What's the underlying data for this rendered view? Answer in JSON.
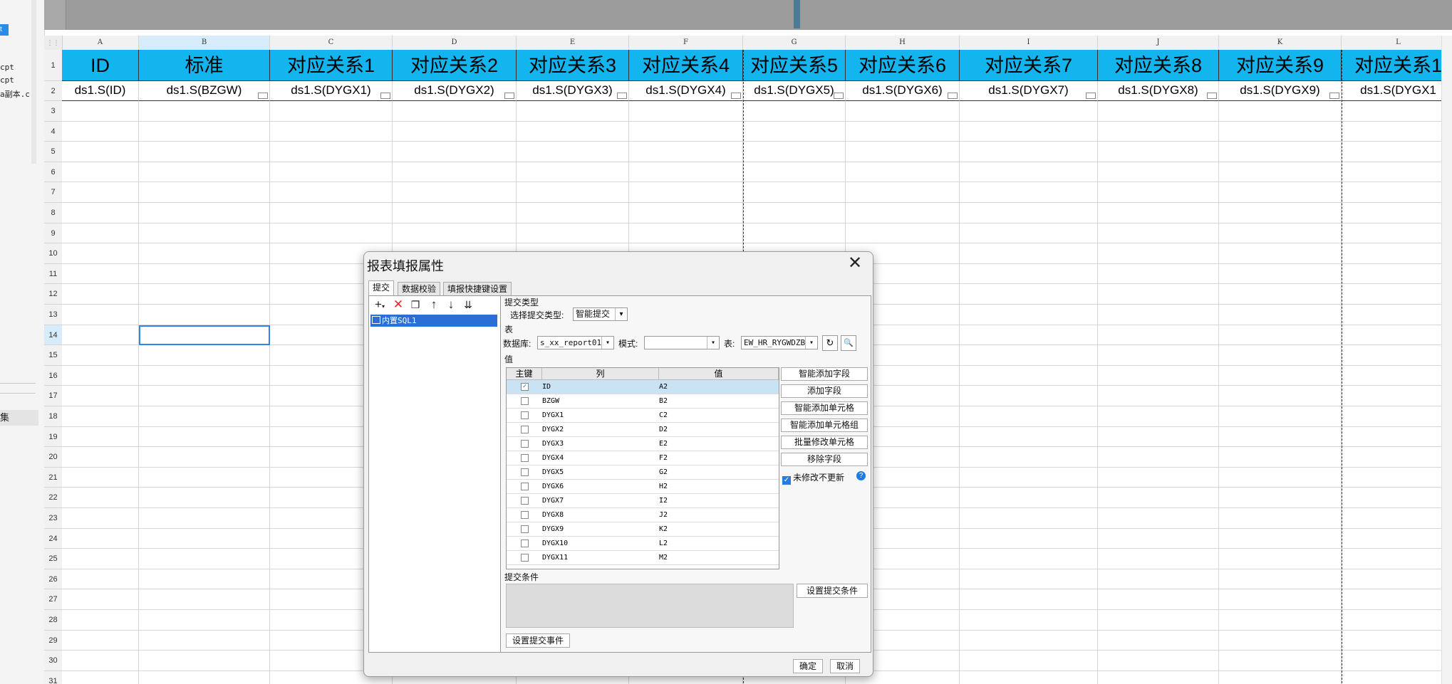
{
  "left_panel": {
    "selected_tag": "t",
    "items": [
      "cpt",
      "cpt",
      "a副本.c"
    ],
    "dataset_label": "集"
  },
  "sheet": {
    "columns": [
      "A",
      "B",
      "C",
      "D",
      "E",
      "F",
      "G",
      "H",
      "I",
      "J",
      "K",
      "L"
    ],
    "rows": [
      "1",
      "2",
      "3",
      "4",
      "5",
      "6",
      "7",
      "8",
      "9",
      "10",
      "11",
      "12",
      "13",
      "14",
      "15",
      "16",
      "17",
      "18",
      "19",
      "20",
      "21",
      "22",
      "23",
      "24",
      "25",
      "26",
      "27",
      "28",
      "29",
      "30",
      "31"
    ],
    "header_cells": [
      "ID",
      "标准",
      "对应关系1",
      "对应关系2",
      "对应关系3",
      "对应关系4",
      "对应关系5",
      "对应关系6",
      "对应关系7",
      "对应关系8",
      "对应关系9",
      "对应关系1"
    ],
    "value_cells": [
      "ds1.S(ID)",
      "ds1.S(BZGW)",
      "ds1.S(DYGX1)",
      "ds1.S(DYGX2)",
      "ds1.S(DYGX3)",
      "ds1.S(DYGX4)",
      "ds1.S(DYGX5)",
      "ds1.S(DYGX6)",
      "ds1.S(DYGX7)",
      "ds1.S(DYGX8)",
      "ds1.S(DYGX9)",
      "ds1.S(DYGX1"
    ],
    "colors": {
      "header_fill": "#13b5ef",
      "selection": "#2f86e8"
    }
  },
  "dialog": {
    "title": "报表填报属性",
    "close_icon": "close-icon",
    "tabs": [
      "提交",
      "数据校验",
      "填报快捷键设置"
    ],
    "toolbar_icons": [
      "add-icon",
      "delete-icon",
      "copy-icon",
      "move-up-icon",
      "move-down-icon",
      "move-bottom-icon"
    ],
    "tree_item": "内置SQL1",
    "submit_type_section": "提交类型",
    "submit_type_label": "选择提交类型:",
    "submit_type_value": "智能提交",
    "table_section": "表",
    "db_label": "数据库:",
    "db_value": "s_xx_report01",
    "schema_label": "模式:",
    "schema_value": "",
    "table_label": "表:",
    "table_value": "EW_HR_RYGWDZB",
    "value_section": "值",
    "grid_headers": [
      "主键",
      "列",
      "值"
    ],
    "grid_rows": [
      {
        "key": true,
        "col": "ID",
        "val": "A2"
      },
      {
        "key": false,
        "col": "BZGW",
        "val": "B2"
      },
      {
        "key": false,
        "col": "DYGX1",
        "val": "C2"
      },
      {
        "key": false,
        "col": "DYGX2",
        "val": "D2"
      },
      {
        "key": false,
        "col": "DYGX3",
        "val": "E2"
      },
      {
        "key": false,
        "col": "DYGX4",
        "val": "F2"
      },
      {
        "key": false,
        "col": "DYGX5",
        "val": "G2"
      },
      {
        "key": false,
        "col": "DYGX6",
        "val": "H2"
      },
      {
        "key": false,
        "col": "DYGX7",
        "val": "I2"
      },
      {
        "key": false,
        "col": "DYGX8",
        "val": "J2"
      },
      {
        "key": false,
        "col": "DYGX9",
        "val": "K2"
      },
      {
        "key": false,
        "col": "DYGX10",
        "val": "L2"
      },
      {
        "key": false,
        "col": "DYGX11",
        "val": "M2"
      }
    ],
    "side_buttons": [
      "智能添加字段",
      "添加字段",
      "智能添加单元格",
      "智能添加单元格组",
      "批量修改单元格",
      "移除字段"
    ],
    "no_update_unchanged": "未修改不更新",
    "condition_section": "提交条件",
    "set_condition_button": "设置提交条件",
    "set_event_button": "设置提交事件",
    "ok_button": "确定",
    "cancel_button": "取消"
  }
}
